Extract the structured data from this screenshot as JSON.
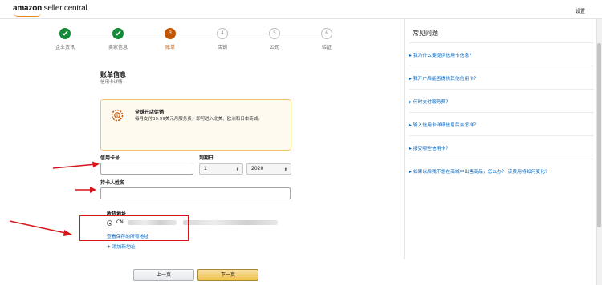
{
  "header": {
    "logo_bold": "amazon",
    "logo_light": " seller central",
    "settings_label": "设置"
  },
  "steps": [
    {
      "num": "✓",
      "label": "企业资讯",
      "state": "done"
    },
    {
      "num": "✓",
      "label": "卖家信息",
      "state": "done"
    },
    {
      "num": "3",
      "label": "账单",
      "state": "current"
    },
    {
      "num": "4",
      "label": "店铺",
      "state": "todo"
    },
    {
      "num": "5",
      "label": "公司",
      "state": "todo"
    },
    {
      "num": "6",
      "label": "验证",
      "state": "todo"
    }
  ],
  "billing": {
    "title": "账单信息",
    "subtitle": "信用卡详情"
  },
  "promo": {
    "title": "全球开店促销",
    "text": "每月支付39.99美元月服务费，即可进入北美、欧洲和日本商城。"
  },
  "form": {
    "card_number_label": "信用卡号",
    "card_number_value": "",
    "expiry_label": "到期日",
    "month_value": "1",
    "year_value": "2020",
    "holder_label": "持卡人姓名",
    "holder_value": ""
  },
  "address": {
    "title": "收货地址",
    "selected": "CN,",
    "view_all": "查看保存的所有地址",
    "add_new": "+ 添加新地址"
  },
  "buttons": {
    "prev": "上一页",
    "next": "下一页"
  },
  "faq": {
    "title": "常见问题",
    "items": [
      "▸ 我为什么要提供信用卡信息？",
      "▸ 我开户后能否提供其他信用卡？",
      "▸ 何时支付服务费？",
      "▸ 输入信用卡详细信息后会怎样？",
      "▸ 接受哪些信用卡？",
      "▸ 如果以后我不想在商城中出售商品，怎么办？ 该费用将如何变化？"
    ]
  },
  "colors": {
    "done": "#138a36",
    "current": "#c45500",
    "link": "#0066c0",
    "annotation": "#d8151b"
  }
}
